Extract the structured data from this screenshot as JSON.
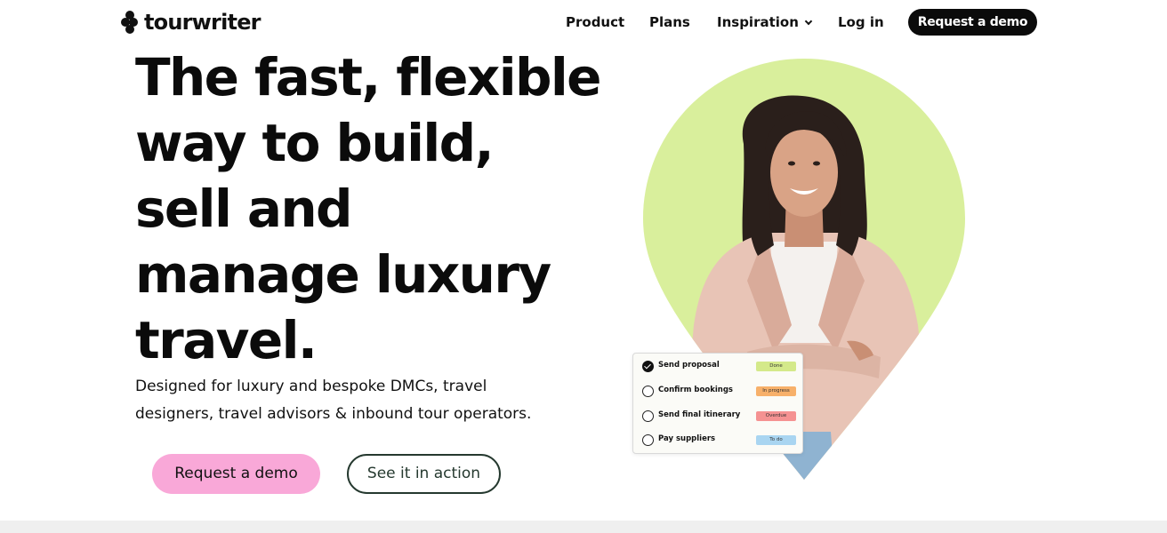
{
  "brand": {
    "name": "tourwriter"
  },
  "nav": {
    "items": [
      {
        "label": "Product"
      },
      {
        "label": "Plans"
      },
      {
        "label": "Inspiration"
      },
      {
        "label": "Log in"
      }
    ],
    "cta_label": "Request a demo"
  },
  "hero": {
    "headline_lines": [
      "The fast, flexible",
      "way to build,",
      "sell and",
      "manage luxury",
      "travel."
    ],
    "subtext_lines": [
      "Designed for luxury and bespoke DMCs, travel",
      "designers, travel advisors & inbound tour operators."
    ],
    "primary_cta": "Request a demo",
    "secondary_cta": "See it in action"
  },
  "task_card": {
    "tasks": [
      {
        "label": "Send proposal",
        "status": "Done",
        "done": true,
        "color": "#d4e98a"
      },
      {
        "label": "Confirm bookings",
        "status": "In progress",
        "done": false,
        "color": "#f7b06a"
      },
      {
        "label": "Send final itinerary",
        "status": "Overdue",
        "done": false,
        "color": "#f59292"
      },
      {
        "label": "Pay suppliers",
        "status": "To do",
        "done": false,
        "color": "#a9d5f1"
      }
    ]
  },
  "colors": {
    "pin_green": "#d9ef9c",
    "pink_button": "#f9a8d8",
    "dark_green_outline": "#25392f",
    "nav_cta_bg": "#0b0b0b"
  }
}
